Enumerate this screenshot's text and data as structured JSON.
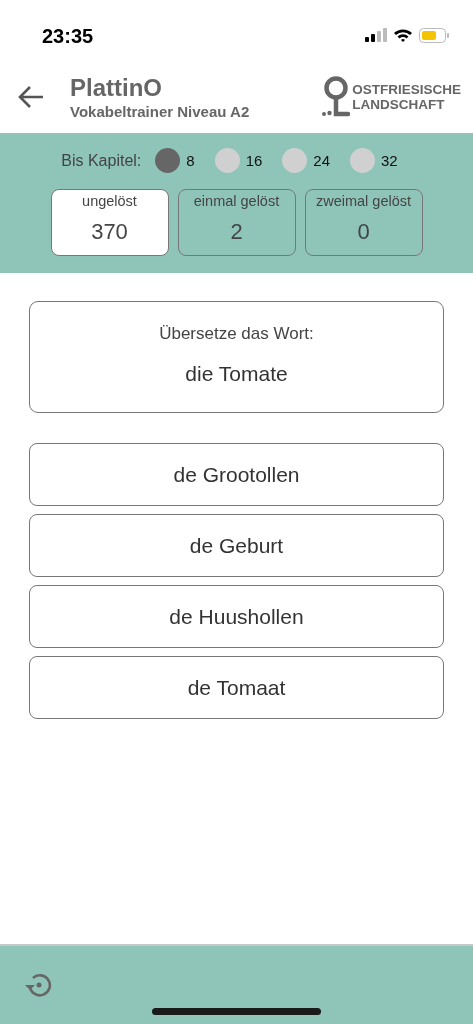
{
  "status_bar": {
    "time": "23:35"
  },
  "header": {
    "title": "PlattinO",
    "subtitle": "Vokabeltrainer Niveau A2",
    "logo": {
      "line_1": "OSTFRIESISCHE",
      "line_2": "LANDSCHAFT"
    }
  },
  "chapter_filter": {
    "label": "Bis Kapitel:",
    "options": [
      {
        "label": "8",
        "selected": true
      },
      {
        "label": "16",
        "selected": false
      },
      {
        "label": "24",
        "selected": false
      },
      {
        "label": "32",
        "selected": false
      }
    ]
  },
  "counters": [
    {
      "label": "ungelöst",
      "value": "370",
      "selected": true
    },
    {
      "label": "einmal gelöst",
      "value": "2",
      "selected": false
    },
    {
      "label": "zweimal gelöst",
      "value": "0",
      "selected": false
    }
  ],
  "question": {
    "prompt": "Übersetze das Wort:",
    "word": "die Tomate"
  },
  "answers": [
    "de Grootollen",
    "de Geburt",
    "de Huushollen",
    "de Tomaat"
  ]
}
